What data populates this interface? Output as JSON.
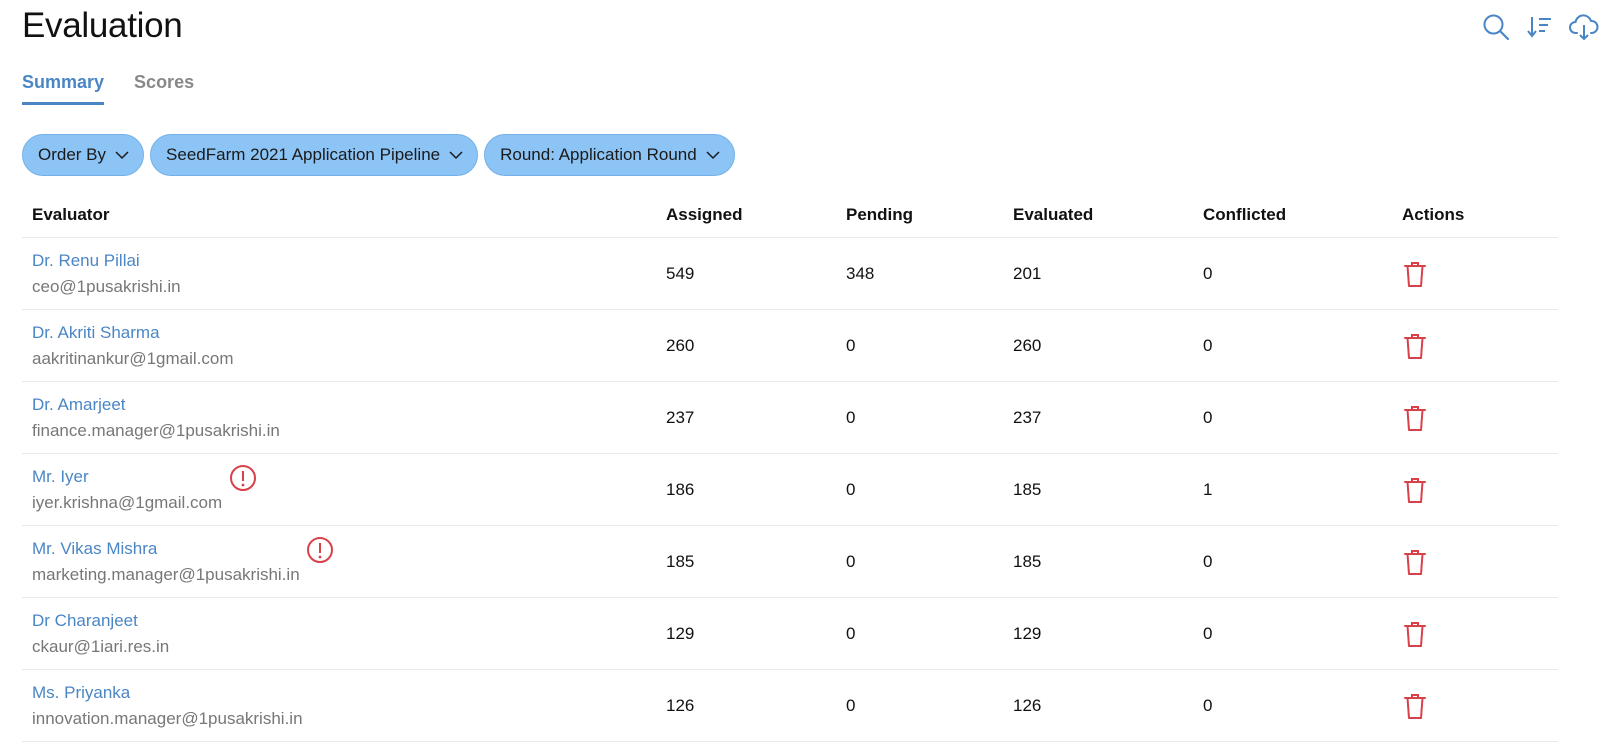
{
  "page": {
    "title": "Evaluation"
  },
  "header_icons": [
    "search-icon",
    "sort-icon",
    "cloud-download-icon"
  ],
  "tabs": [
    {
      "label": "Summary",
      "active": true
    },
    {
      "label": "Scores",
      "active": false
    }
  ],
  "filters": [
    {
      "label": "Order By"
    },
    {
      "label": "SeedFarm 2021 Application Pipeline"
    },
    {
      "label": "Round: Application Round"
    }
  ],
  "table": {
    "headers": [
      "Evaluator",
      "Assigned",
      "Pending",
      "Evaluated",
      "Conflicted",
      "Actions"
    ],
    "rows": [
      {
        "name": "Dr. Renu Pillai",
        "email": "ceo@1pusakrishi.in",
        "assigned": "549",
        "pending": "348",
        "evaluated": "201",
        "conflicted": "0",
        "alert": false
      },
      {
        "name": "Dr. Akriti Sharma",
        "email": "aakritinankur@1gmail.com",
        "assigned": "260",
        "pending": "0",
        "evaluated": "260",
        "conflicted": "0",
        "alert": false
      },
      {
        "name": "Dr. Amarjeet",
        "email": "finance.manager@1pusakrishi.in",
        "assigned": "237",
        "pending": "0",
        "evaluated": "237",
        "conflicted": "0",
        "alert": false
      },
      {
        "name": "Mr. Iyer",
        "email": "iyer.krishna@1gmail.com",
        "assigned": "186",
        "pending": "0",
        "evaluated": "185",
        "conflicted": "1",
        "alert": true
      },
      {
        "name": "Mr. Vikas Mishra",
        "email": "marketing.manager@1pusakrishi.in",
        "assigned": "185",
        "pending": "0",
        "evaluated": "185",
        "conflicted": "0",
        "alert": true
      },
      {
        "name": "Dr Charanjeet",
        "email": "ckaur@1iari.res.in",
        "assigned": "129",
        "pending": "0",
        "evaluated": "129",
        "conflicted": "0",
        "alert": false
      },
      {
        "name": "Ms. Priyanka",
        "email": "innovation.manager@1pusakrishi.in",
        "assigned": "126",
        "pending": "0",
        "evaluated": "126",
        "conflicted": "0",
        "alert": false
      }
    ]
  },
  "colors": {
    "accent": "#4a86c5",
    "pill": "#8cc4f5",
    "danger": "#d9414a"
  }
}
